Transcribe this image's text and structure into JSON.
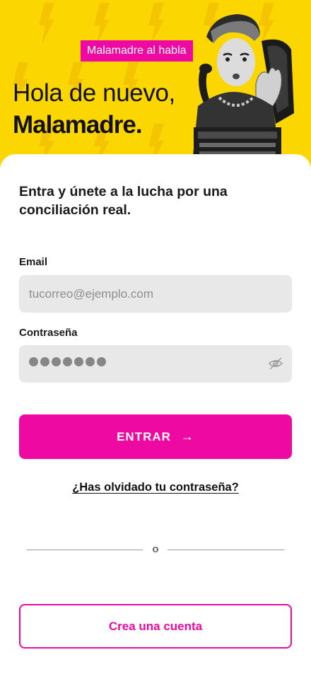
{
  "hero": {
    "tag": "Malamadre al habla",
    "greeting": "Hola de nuevo,",
    "name": "Malamadre."
  },
  "form": {
    "intro": "Entra y únete a la lucha por una conciliación real.",
    "email_label": "Email",
    "email_placeholder": "tucorreo@ejemplo.com",
    "password_label": "Contraseña",
    "password_mask": "●●●●●●●",
    "submit_label": "ENTRAR",
    "submit_arrow": "→",
    "forgot_label": "¿Has olvidado tu contraseña?",
    "divider_text": "o",
    "create_account_label": "Crea una cuenta"
  },
  "colors": {
    "brand_yellow": "#fcd600",
    "brand_pink": "#ee0aa2",
    "field_bg": "#e8e8e8"
  },
  "icons": {
    "hero_pattern": "lightning-bolt-icon",
    "password_toggle": "eye-off-icon",
    "submit_arrow": "arrow-right-icon"
  }
}
